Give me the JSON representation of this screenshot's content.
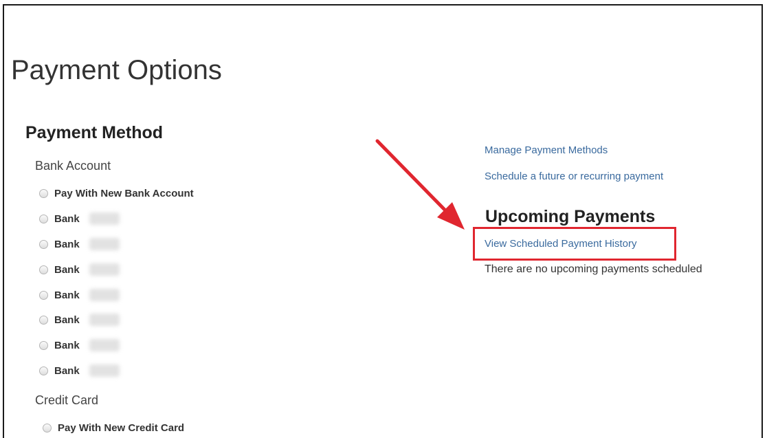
{
  "page": {
    "title": "Payment Options"
  },
  "payment_method": {
    "title": "Payment Method",
    "bank_account": {
      "label": "Bank Account",
      "options": [
        {
          "label": "Pay With New Bank Account",
          "redacted": false
        },
        {
          "label": "Bank",
          "redacted": true
        },
        {
          "label": "Bank",
          "redacted": true
        },
        {
          "label": "Bank",
          "redacted": true
        },
        {
          "label": "Bank",
          "redacted": true
        },
        {
          "label": "Bank",
          "redacted": true
        },
        {
          "label": "Bank",
          "redacted": true
        },
        {
          "label": "Bank",
          "redacted": true
        }
      ]
    },
    "credit_card": {
      "label": "Credit Card",
      "options": [
        {
          "label": "Pay With New Credit Card",
          "redacted": false
        }
      ]
    }
  },
  "links": {
    "manage_methods": "Manage Payment Methods",
    "schedule_payment": "Schedule a future or recurring payment"
  },
  "upcoming": {
    "title": "Upcoming Payments",
    "history_link": "View Scheduled Payment History",
    "empty_message": "There are no upcoming payments scheduled"
  },
  "annotation": {
    "arrow_color": "#e0262f",
    "box_color": "#e0262f"
  },
  "colors": {
    "link": "#3a6a9e",
    "text": "#333333"
  }
}
